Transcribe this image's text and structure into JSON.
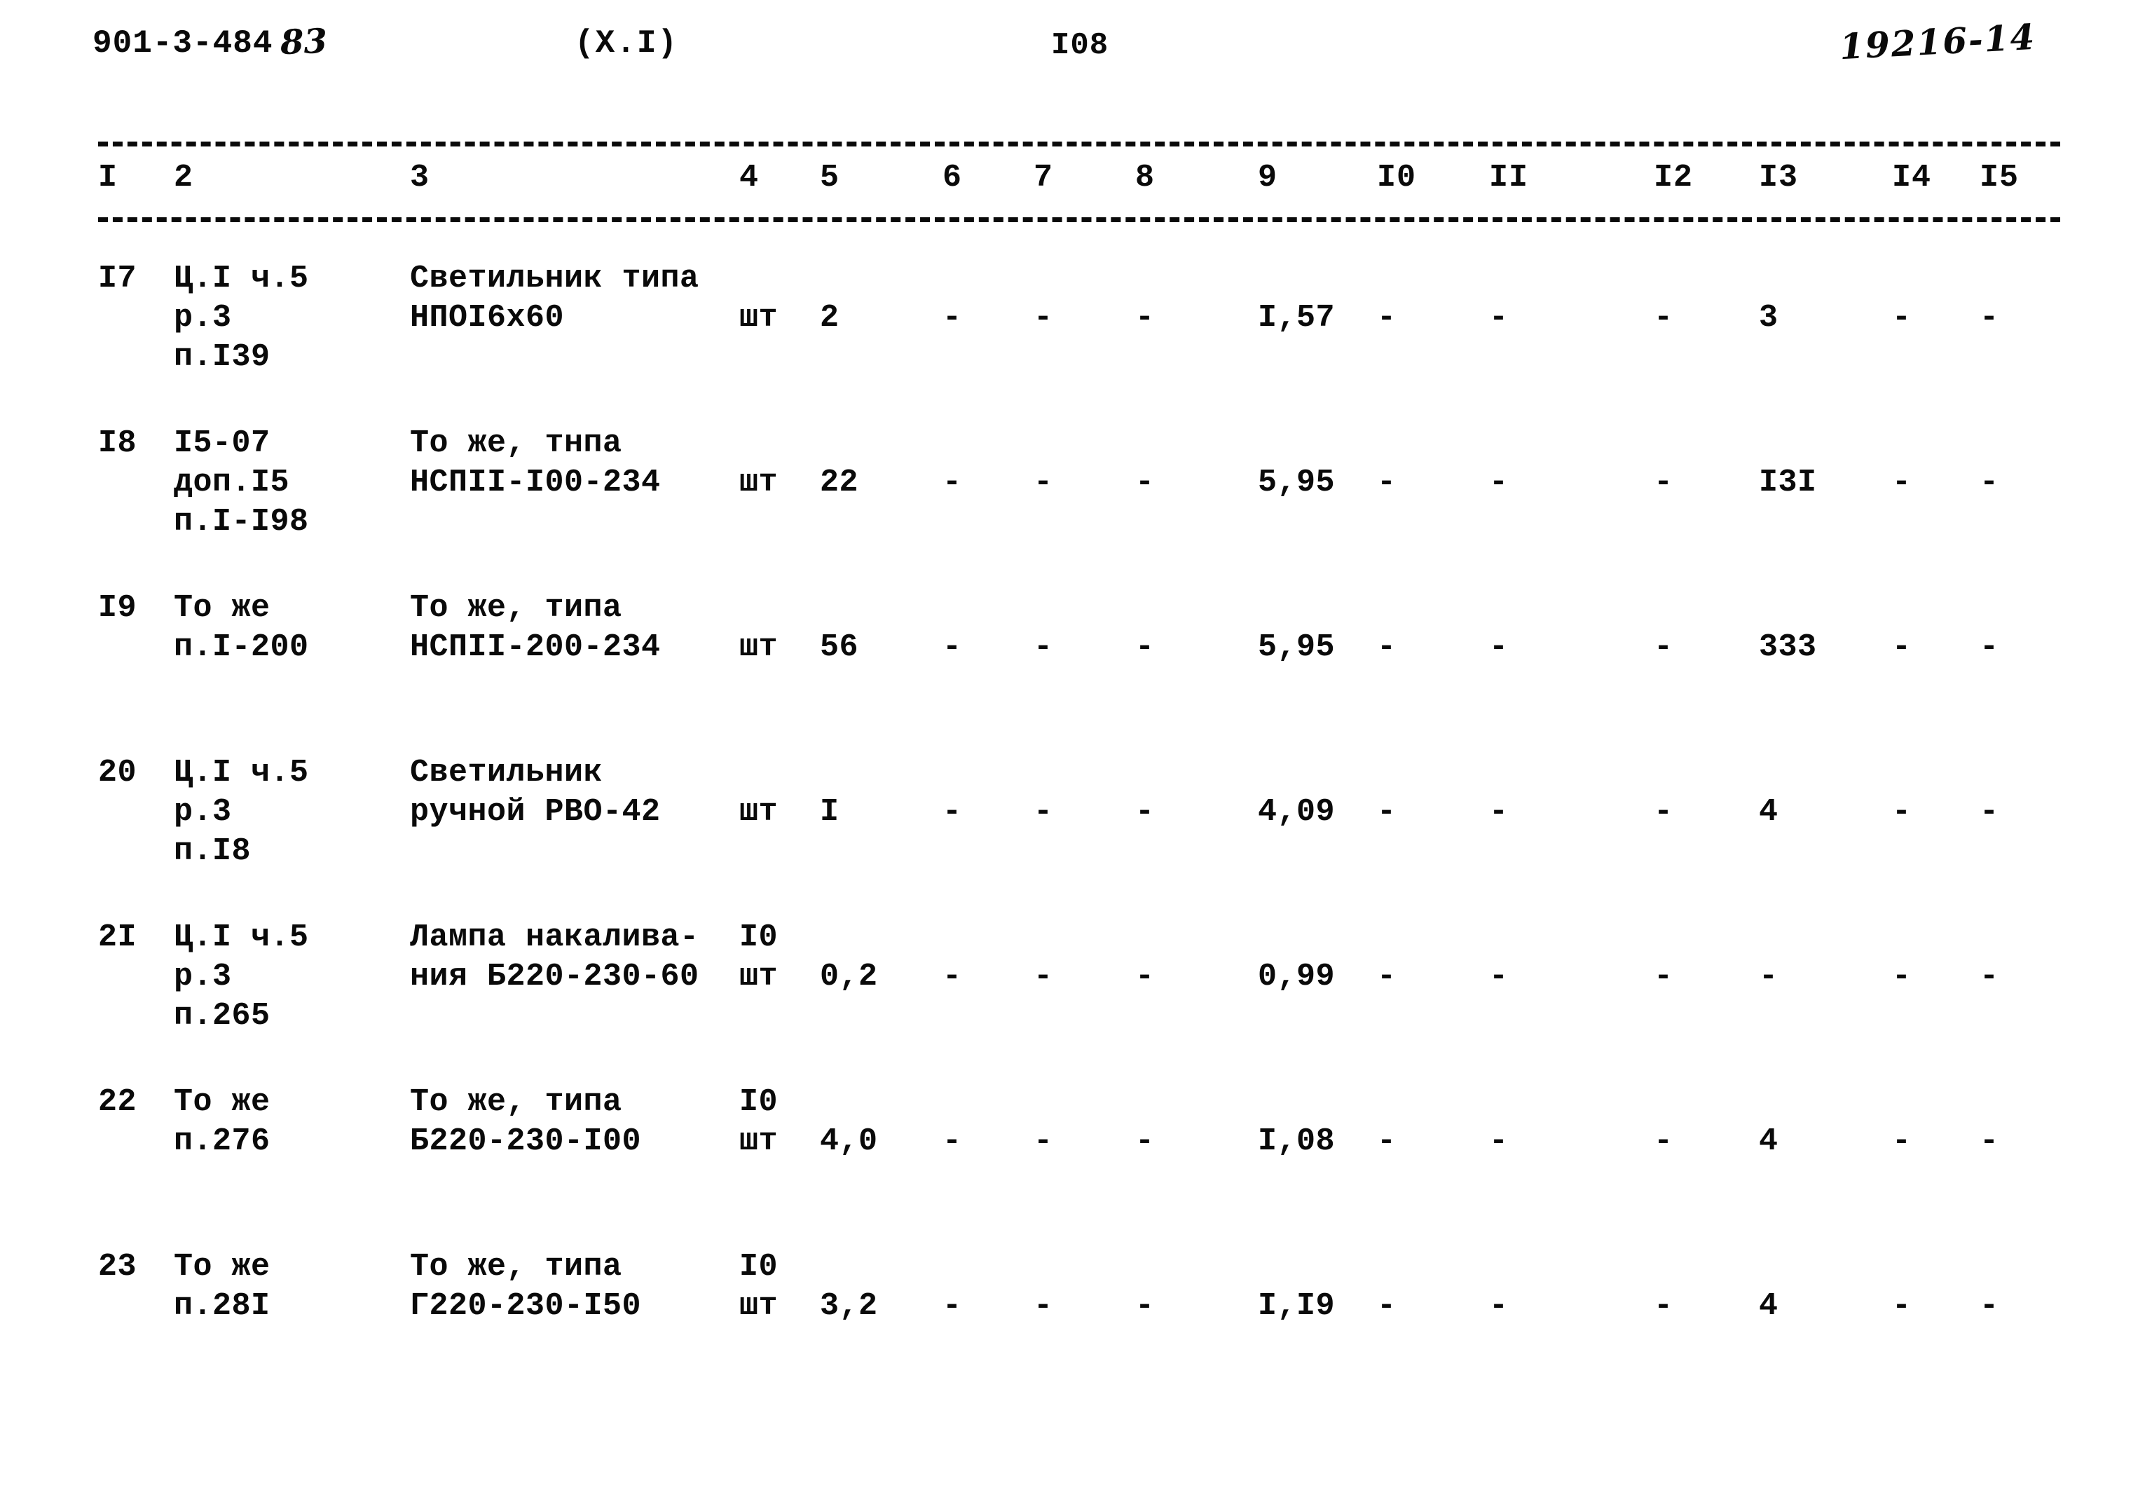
{
  "header": {
    "document_code": "901-3-484",
    "handwritten_year": "83",
    "part": "(X.I)",
    "page_number": "I08",
    "handwritten_archive": "19216-14"
  },
  "table": {
    "column_headers": [
      "I",
      "2",
      "3",
      "4",
      "5",
      "6",
      "7",
      "8",
      "9",
      "I0",
      "II",
      "I2",
      "I3",
      "I4",
      "I5"
    ],
    "rows": [
      {
        "num": "I7",
        "justification": "Ц.I ч.5\nр.3\nп.I39",
        "name": "Светильник типа\nНПОI6х60",
        "unit": "шт",
        "qty": "2",
        "c6": "-",
        "c7": "-",
        "c8": "-",
        "c9": "I,57",
        "c10": "-",
        "c11": "-",
        "c12": "-",
        "c13": "3",
        "c14": "-",
        "c15": "-"
      },
      {
        "num": "I8",
        "justification": "I5-07\nдоп.I5\nп.I-I98",
        "name": "То же, тнпа\nНСПII-I00-234",
        "unit": "шт",
        "qty": "22",
        "c6": "-",
        "c7": "-",
        "c8": "-",
        "c9": "5,95",
        "c10": "-",
        "c11": "-",
        "c12": "-",
        "c13": "I3I",
        "c14": "-",
        "c15": "-"
      },
      {
        "num": "I9",
        "justification": "То же\nп.I-200",
        "name": "То же, типа\nНСПII-200-234",
        "unit": "шт",
        "qty": "56",
        "c6": "-",
        "c7": "-",
        "c8": "-",
        "c9": "5,95",
        "c10": "-",
        "c11": "-",
        "c12": "-",
        "c13": "333",
        "c14": "-",
        "c15": "-"
      },
      {
        "num": "20",
        "justification": "Ц.I ч.5\nр.3\nп.I8",
        "name": "Светильник\nручной РВО-42",
        "unit": "шт",
        "qty": "I",
        "c6": "-",
        "c7": "-",
        "c8": "-",
        "c9": "4,09",
        "c10": "-",
        "c11": "-",
        "c12": "-",
        "c13": "4",
        "c14": "-",
        "c15": "-"
      },
      {
        "num": "2I",
        "justification": "Ц.I ч.5\nр.3\nп.265",
        "name": "Лампа накалива-\nния Б220-230-60",
        "unit": "I0\nшт",
        "qty": "0,2",
        "c6": "-",
        "c7": "-",
        "c8": "-",
        "c9": "0,99",
        "c10": "-",
        "c11": "-",
        "c12": "-",
        "c13": "-",
        "c14": "-",
        "c15": "-"
      },
      {
        "num": "22",
        "justification": "То же\nп.276",
        "name": "То же, типа\nБ220-230-I00",
        "unit": "I0\nшт",
        "qty": "4,0",
        "c6": "-",
        "c7": "-",
        "c8": "-",
        "c9": "I,08",
        "c10": "-",
        "c11": "-",
        "c12": "-",
        "c13": "4",
        "c14": "-",
        "c15": "-"
      },
      {
        "num": "23",
        "justification": "То же\nп.28I",
        "name": "То же, типа\nГ220-230-I50",
        "unit": "I0\nшт",
        "qty": "3,2",
        "c6": "-",
        "c7": "-",
        "c8": "-",
        "c9": "I,I9",
        "c10": "-",
        "c11": "-",
        "c12": "-",
        "c13": "4",
        "c14": "-",
        "c15": "-"
      }
    ]
  }
}
